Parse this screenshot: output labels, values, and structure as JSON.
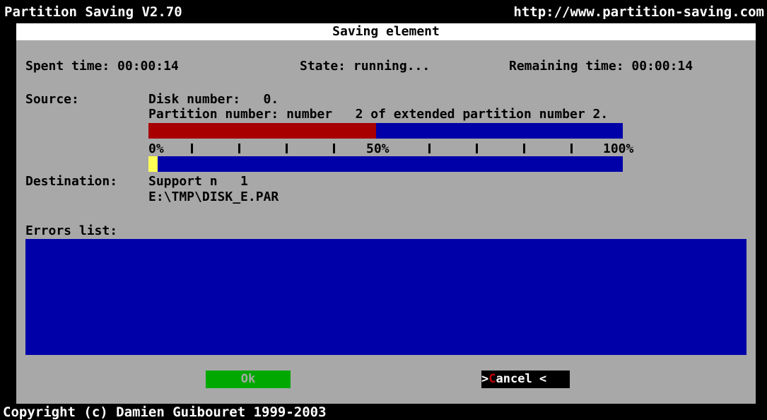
{
  "app": {
    "title": "Partition Saving V2.70",
    "url": "http://www.partition-saving.com",
    "copyright": "Copyright (c) Damien Guibouret 1999-2003"
  },
  "dialog": {
    "title": "Saving element",
    "spent_time": "Spent time: 00:00:14",
    "state": "State: running...",
    "remaining_time": "Remaining time: 00:00:14",
    "source_label": "Source:",
    "disk_number": "Disk number:   0.",
    "partition_number": "Partition number: number   2 of extended partition number 2.",
    "scale_0": "0%",
    "scale_50": "50%",
    "scale_100": "100%",
    "destination_label": "Destination:",
    "support": "Support n   1",
    "file_path": "E:\\TMP\\DISK_E.PAR",
    "errors_label": "Errors list:",
    "errors": [],
    "source_progress_fraction": 0.48,
    "destination_progress_fraction": 0.02
  },
  "buttons": {
    "ok": "Ok",
    "cancel_prefix": ">",
    "cancel_hotkey": "C",
    "cancel_rest": "ancel <"
  },
  "colors": {
    "dialog_bg": "#a8a8a8",
    "bar_blue": "#0000a8",
    "progress_red": "#a80000",
    "progress_yellow": "#ffff55",
    "ok_green": "#00a800"
  }
}
